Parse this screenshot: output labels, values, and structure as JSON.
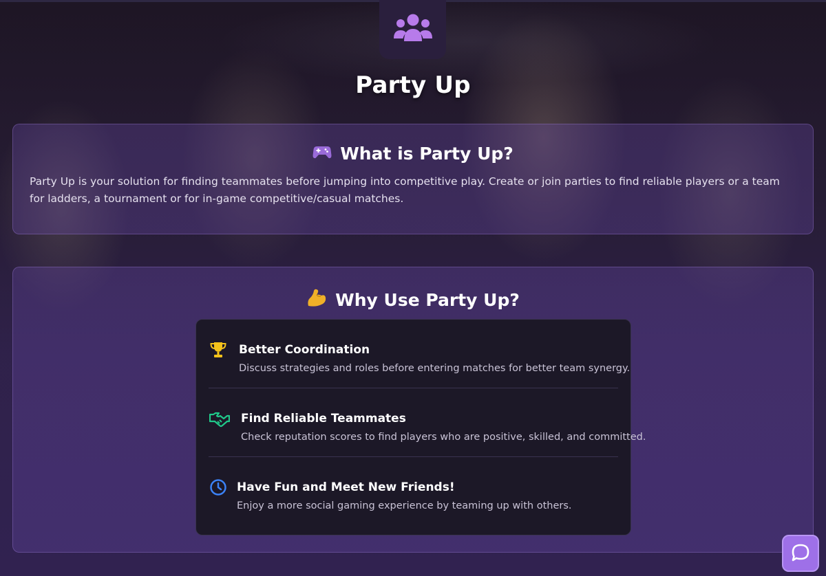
{
  "page": {
    "title": "Party Up",
    "hero_icon": "users-group-icon"
  },
  "what_section": {
    "emoji_icon": "gamepad-icon",
    "heading": "What is Party Up?",
    "text": "Party Up is your solution for finding teammates before jumping into competitive play. Create or join parties to find reliable players or a team for ladders, a tournament or for in-game competitive/casual matches."
  },
  "why_section": {
    "emoji_icon": "flexed-bicep-icon",
    "heading": "Why Use Party Up?",
    "benefits": [
      {
        "icon": "trophy-icon",
        "icon_color": "#f4c21b",
        "title": "Better Coordination",
        "description": "Discuss strategies and roles before entering matches for better team synergy."
      },
      {
        "icon": "handshake-icon",
        "icon_color": "#20c98a",
        "title": "Find Reliable Teammates",
        "description": "Check reputation scores to find players who are positive, skilled, and committed."
      },
      {
        "icon": "clock-icon",
        "icon_color": "#3b82f6",
        "title": "Have Fun and Meet New Friends!",
        "description": "Enjoy a more social gaming experience by teaming up with others."
      }
    ]
  },
  "chat_button": {
    "icon": "chat-bubble-icon"
  },
  "colors": {
    "accent": "#9e70e8",
    "card_bg": "#6a4bb0",
    "panel_bg": "#1c1827"
  }
}
